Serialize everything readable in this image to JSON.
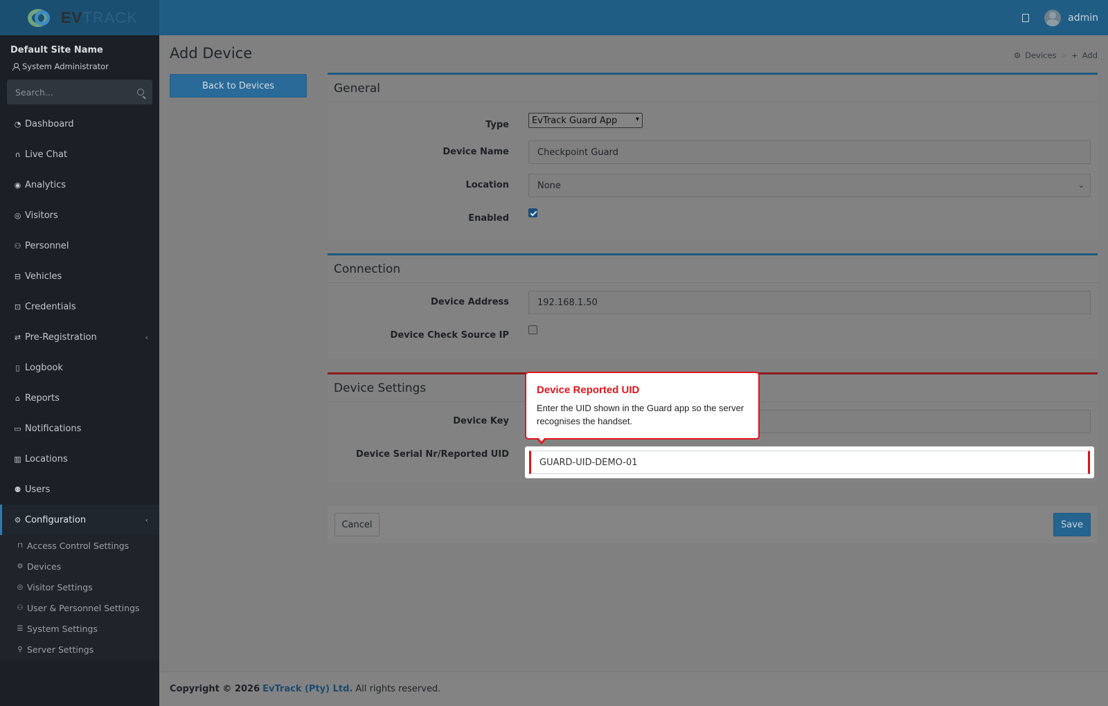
{
  "brand": {
    "name_bold": "EV",
    "name_rest": "TRACK"
  },
  "topbar": {
    "user": "admin",
    "book_icon": "book-icon"
  },
  "sidebar": {
    "site_name": "Default Site Name",
    "role": "System Administrator",
    "search_placeholder": "Search...",
    "items": [
      {
        "label": "Dashboard",
        "icon": "gauge-icon"
      },
      {
        "label": "Live Chat",
        "icon": "headset-icon"
      },
      {
        "label": "Analytics",
        "icon": "target-icon"
      },
      {
        "label": "Visitors",
        "icon": "eye-icon"
      },
      {
        "label": "Personnel",
        "icon": "person-gear-icon"
      },
      {
        "label": "Vehicles",
        "icon": "car-icon"
      },
      {
        "label": "Credentials",
        "icon": "id-card-icon"
      },
      {
        "label": "Pre-Registration",
        "icon": "arrows-icon"
      },
      {
        "label": "Logbook",
        "icon": "book-icon"
      },
      {
        "label": "Reports",
        "icon": "chart-icon"
      },
      {
        "label": "Notifications",
        "icon": "chat-icon"
      },
      {
        "label": "Locations",
        "icon": "map-icon"
      },
      {
        "label": "Users",
        "icon": "users-icon"
      },
      {
        "label": "Configuration",
        "icon": "gear-icon"
      }
    ],
    "config_sub": [
      {
        "label": "Access Control Settings",
        "icon": "lock-icon"
      },
      {
        "label": "Devices",
        "icon": "gear-icon"
      },
      {
        "label": "Visitor Settings",
        "icon": "eye-icon"
      },
      {
        "label": "User & Personnel Settings",
        "icon": "user-gear-icon"
      },
      {
        "label": "System Settings",
        "icon": "sliders-icon"
      },
      {
        "label": "Server Settings",
        "icon": "wrench-icon"
      }
    ]
  },
  "page": {
    "title": "Add Device",
    "breadcrumb": {
      "parent": "Devices",
      "current": "Add"
    },
    "back_button": "Back to Devices"
  },
  "general": {
    "heading": "General",
    "type_label": "Type",
    "type_value": "EvTrack Guard App",
    "name_label": "Device Name",
    "name_value": "Checkpoint Guard",
    "location_label": "Location",
    "location_value": "None",
    "enabled_label": "Enabled",
    "enabled": true
  },
  "connection": {
    "heading": "Connection",
    "address_label": "Device Address",
    "address_value": "192.168.1.50",
    "check_ip_label": "Device Check Source IP",
    "check_ip": false
  },
  "device_settings": {
    "heading": "Device Settings",
    "key_label": "Device Key",
    "key_value": "",
    "uid_label": "Device Serial Nr/Reported UID",
    "uid_value": "GUARD-UID-DEMO-01"
  },
  "tooltip": {
    "title": "Device Reported UID",
    "body": "Enter the UID shown in the Guard app so the server recognises the handset."
  },
  "actions": {
    "cancel": "Cancel",
    "save": "Save"
  },
  "footer": {
    "prefix": "Copyright © 2026",
    "company": "EvTrack (Pty) Ltd.",
    "suffix": "All rights reserved."
  }
}
